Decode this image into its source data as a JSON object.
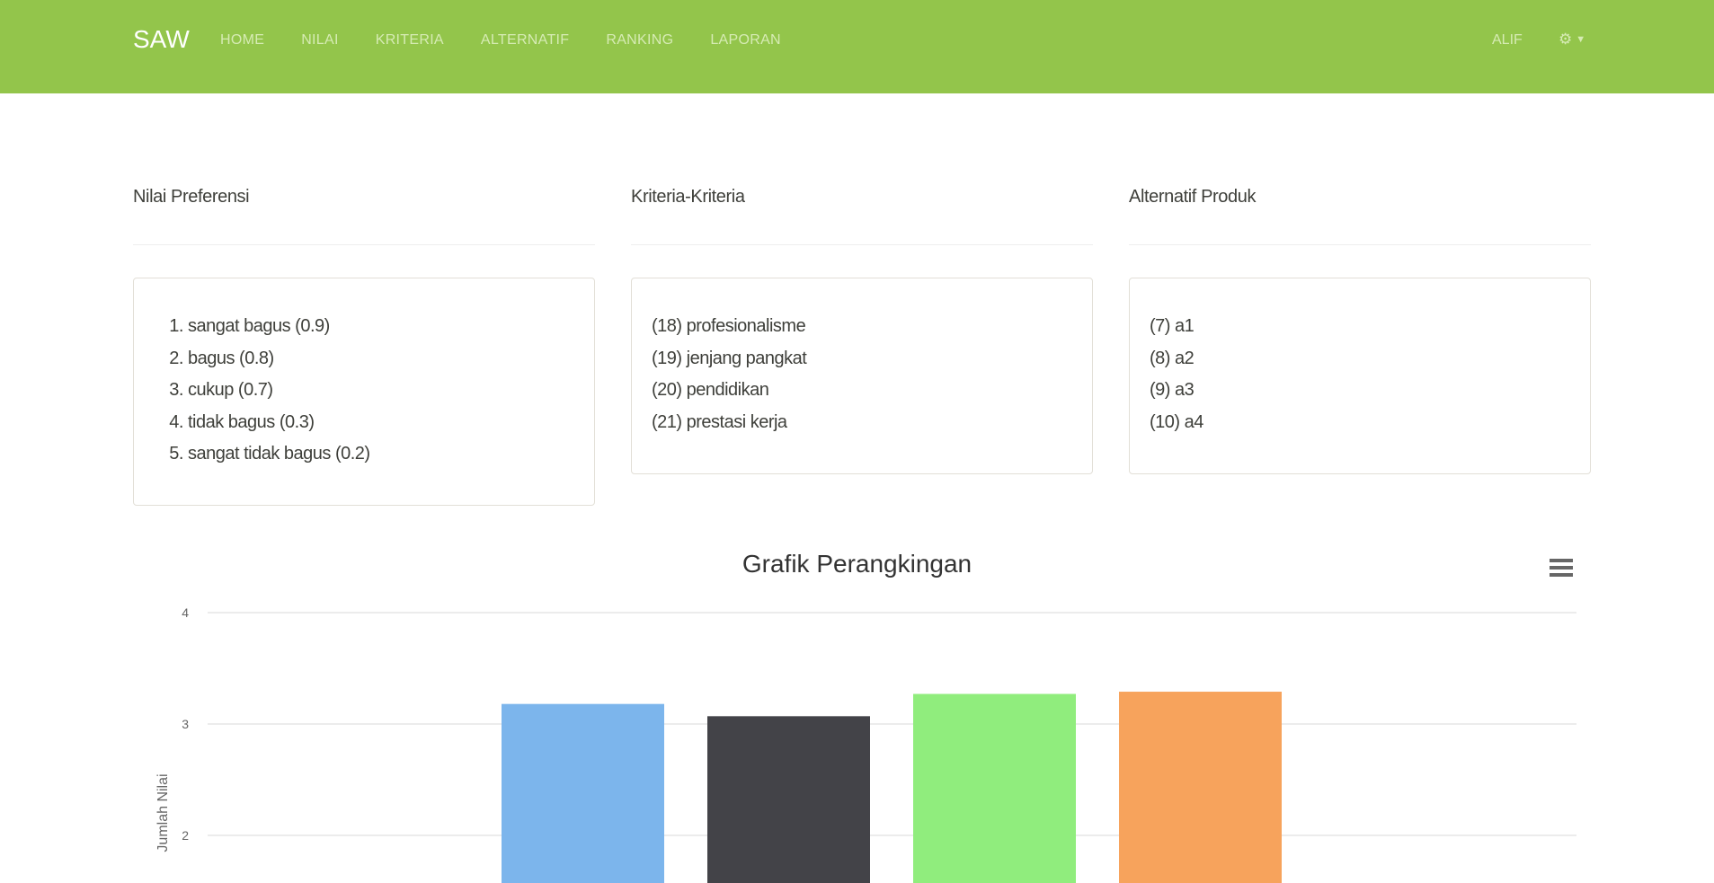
{
  "navbar": {
    "brand": "SAW",
    "links": [
      "HOME",
      "NILAI",
      "KRITERIA",
      "ALTERNATIF",
      "RANKING",
      "LAPORAN"
    ],
    "user": "ALIF",
    "colors": {
      "background": "#93c54b",
      "link": "#d6ebb4",
      "brand": "#ffffff"
    }
  },
  "panels": {
    "preferensi": {
      "title": "Nilai Preferensi",
      "items": [
        "sangat bagus (0.9)",
        "bagus (0.8)",
        "cukup (0.7)",
        "tidak bagus (0.3)",
        "sangat tidak bagus (0.2)"
      ]
    },
    "kriteria": {
      "title": "Kriteria-Kriteria",
      "items": [
        "(18) profesionalisme",
        "(19) jenjang pangkat",
        "(20) pendidikan",
        "(21) prestasi kerja"
      ]
    },
    "alternatif": {
      "title": "Alternatif Produk",
      "items": [
        "(7) a1",
        "(8) a2",
        "(9) a3",
        "(10) a4"
      ]
    }
  },
  "chart_data": {
    "type": "bar",
    "title": "Grafik Perangkingan",
    "ylabel": "Jumlah Nilai",
    "yticks": [
      2,
      3,
      4
    ],
    "ylim": [
      0,
      4
    ],
    "grid": true,
    "series": [
      {
        "values": [
          3.18
        ],
        "color": "#7cb5ec"
      },
      {
        "values": [
          3.07
        ],
        "color": "#434348"
      },
      {
        "values": [
          3.27
        ],
        "color": "#90ed7d"
      },
      {
        "values": [
          3.29
        ],
        "color": "#f7a35c"
      }
    ]
  }
}
